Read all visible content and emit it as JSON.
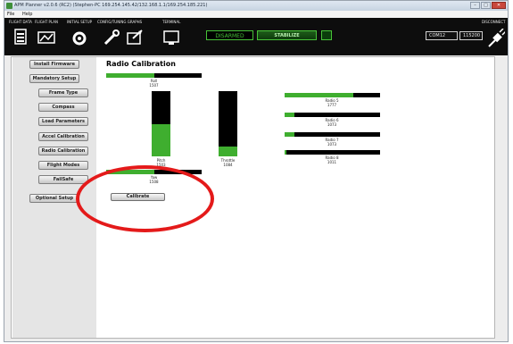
{
  "window": {
    "title": "APM Planner v2.0.6 (RC2) (Stephen-PC 169.254.145.42/132.168.1.1/169.254.185.221)",
    "minimize": "–",
    "maximize": "□",
    "close": "✕"
  },
  "menu": [
    "File",
    "Help"
  ],
  "toolbar": {
    "items": [
      {
        "label": "FLIGHT DATA",
        "icon": "flight-data-icon"
      },
      {
        "label": "FLIGHT PLAN",
        "icon": "flight-plan-icon"
      },
      {
        "label": "INITIAL SETUP",
        "icon": "initial-setup-icon"
      },
      {
        "label": "CONFIG/TUNING",
        "icon": "config-tuning-icon"
      },
      {
        "label": "GRAPHS",
        "icon": "graphs-icon"
      },
      {
        "label": "TERMINAL",
        "icon": "terminal-icon"
      }
    ],
    "armed_status": "DISARMED",
    "flight_mode": "STABILIZE",
    "port": "COM12",
    "baud": "115200",
    "disconnect": "DISCONNECT",
    "accent": "#47c238"
  },
  "sidebar": [
    "Install Firmware",
    "Mandatory Setup",
    "Frame Type",
    "Compass",
    "Load Parameters",
    "Accel Calibration",
    "Radio Calibration",
    "Flight Modes",
    "FailSafe",
    "Optional Setup"
  ],
  "radio": {
    "title": "Radio Calibration",
    "channels": [
      {
        "name": "Roll",
        "value": "1507",
        "level": 0.5
      },
      {
        "name": "Pitch",
        "value": "1503",
        "level": 0.5
      },
      {
        "name": "Throttle",
        "value": "1084",
        "level": 0.15
      },
      {
        "name": "Yaw",
        "value": "1508",
        "level": 0.5
      },
      {
        "name": "Radio 5",
        "value": "1777",
        "level": 0.72
      },
      {
        "name": "Radio 6",
        "value": "1073",
        "level": 0.1
      },
      {
        "name": "Radio 7",
        "value": "1073",
        "level": 0.1
      },
      {
        "name": "Radio 8",
        "value": "1011",
        "level": 0.02
      }
    ],
    "calibrate_label": "Calibrate"
  }
}
